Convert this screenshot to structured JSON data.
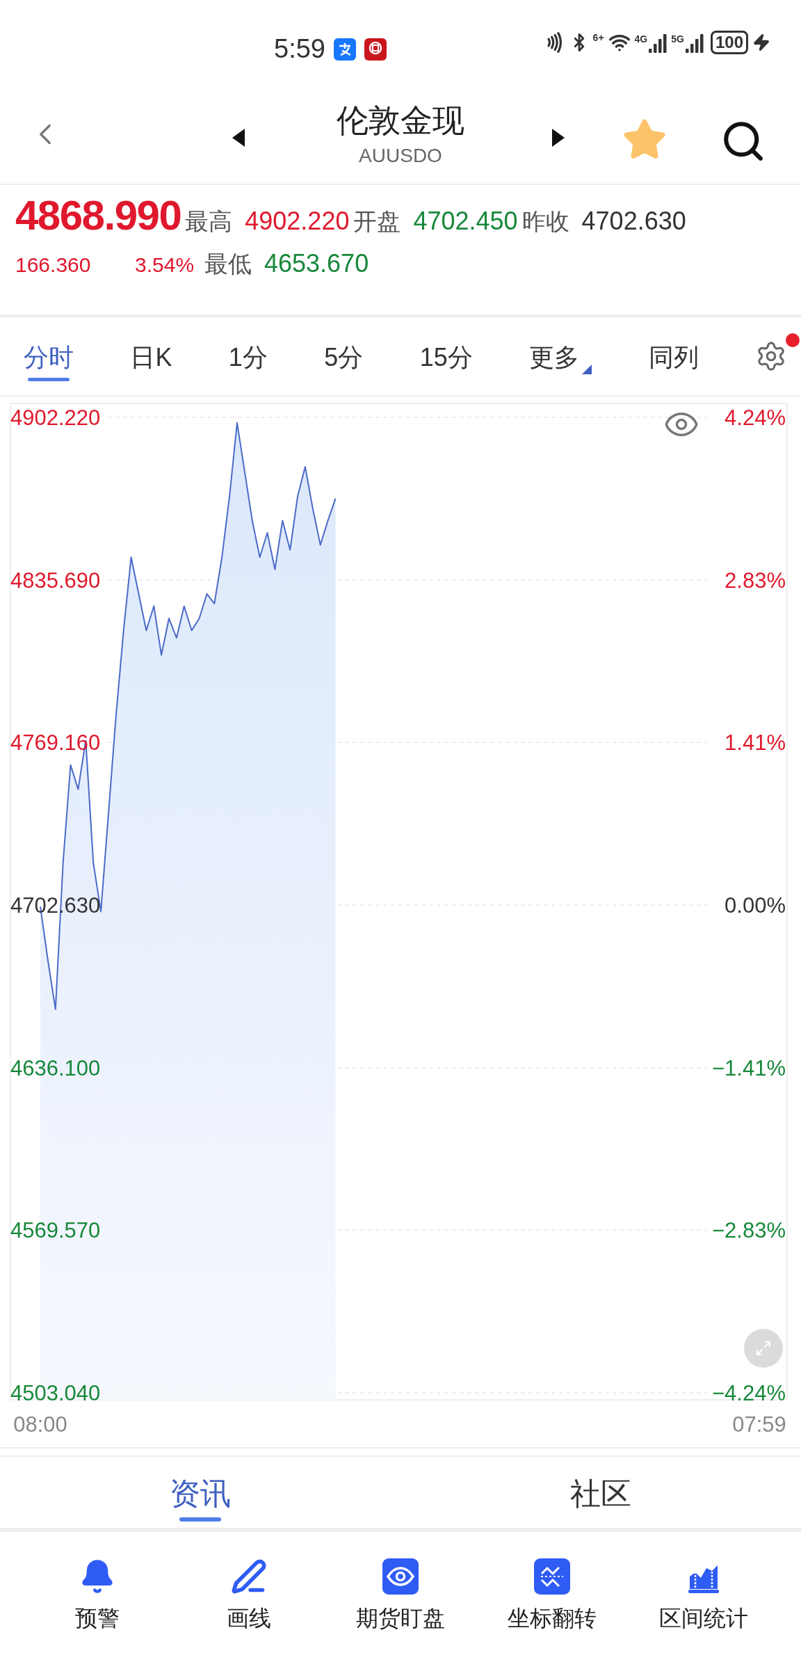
{
  "status_bar": {
    "time": "5:59",
    "wifi_label": "6+",
    "networks": [
      {
        "label": "4G"
      },
      {
        "label": "5G"
      }
    ],
    "battery": "100"
  },
  "header": {
    "title": "伦敦金现",
    "code": "AUUSDO",
    "favorite": true
  },
  "quote": {
    "price": {
      "text": "4868.990",
      "color": "#e0182d"
    },
    "change": {
      "text": "166.360",
      "color": "#e0182d"
    },
    "change_pct": {
      "text": "3.54%",
      "color": "#e0182d"
    },
    "stats": [
      {
        "label": "最高",
        "value": "4902.220",
        "color": "#e0182d"
      },
      {
        "label": "开盘",
        "value": "4702.450",
        "color": "#17883a"
      },
      {
        "label": "昨收",
        "value": "4702.630",
        "color": "#333333"
      },
      {
        "label": "最低",
        "value": "4653.670",
        "color": "#17883a"
      }
    ]
  },
  "period_tabs": [
    {
      "label": "分时",
      "selected": true
    },
    {
      "label": "日K",
      "selected": false
    },
    {
      "label": "1分",
      "selected": false
    },
    {
      "label": "5分",
      "selected": false
    },
    {
      "label": "15分",
      "selected": false
    },
    {
      "label": "更多",
      "selected": false,
      "kind": "menu"
    },
    {
      "label": "同列",
      "selected": false
    }
  ],
  "settings": {
    "badge": true
  },
  "chart": {
    "chart_data": {
      "type": "area",
      "categories": [
        "08:00",
        null,
        null,
        null,
        null,
        null,
        null,
        null,
        null,
        null,
        null,
        null,
        null,
        null,
        null,
        null,
        null,
        null,
        null,
        null,
        null,
        null,
        null,
        null,
        null,
        null,
        null,
        null,
        null,
        null,
        null,
        null,
        null,
        null,
        null,
        null,
        null,
        null,
        null,
        null,
        null,
        null,
        null,
        null,
        null,
        null,
        null,
        null,
        null,
        null,
        null,
        null,
        null,
        null,
        null,
        null,
        null,
        null,
        null,
        null,
        null,
        null,
        null,
        null,
        null,
        null,
        null,
        null,
        null,
        null,
        null,
        null,
        null,
        null,
        null,
        null,
        null,
        null,
        null,
        null,
        null,
        null,
        null,
        null,
        null,
        null,
        null,
        null,
        null,
        null,
        null,
        null,
        null,
        null,
        null,
        "07:59"
      ],
      "series": [
        {
          "color": "#4a6bc8",
          "values": [
            4702,
            4680,
            4660,
            4720,
            4760,
            4750,
            4770,
            4720,
            4700,
            4740,
            4780,
            4815,
            4845,
            4830,
            4815,
            4825,
            4805,
            4820,
            4812,
            4825,
            4815,
            4820,
            4830,
            4826,
            4845,
            4870,
            4900,
            4880,
            4860,
            4845,
            4855,
            4840,
            4860,
            4848,
            4870,
            4882,
            4865,
            4850,
            4860,
            4869,
            null,
            null,
            null,
            null,
            null,
            null,
            null,
            null,
            null,
            null,
            null,
            null,
            null,
            null,
            null,
            null,
            null,
            null,
            null,
            null,
            null,
            null,
            null,
            null,
            null,
            null,
            null,
            null,
            null,
            null,
            null,
            null,
            null,
            null,
            null,
            null,
            null,
            null,
            null,
            null,
            null,
            null,
            null,
            null,
            null,
            null,
            null,
            null,
            null,
            null,
            null,
            null,
            null,
            null,
            null,
            null
          ]
        }
      ],
      "ylim": [
        4503.04,
        4902.22
      ],
      "grid": true,
      "yticks": [
        {
          "value": 4902.22,
          "label": "4902.220"
        },
        {
          "value": 4835.69,
          "label": "4835.690"
        },
        {
          "value": 4769.16,
          "label": "4769.160"
        },
        {
          "value": 4702.63,
          "label": "4702.630"
        },
        {
          "value": 4636.1,
          "label": "4636.100"
        },
        {
          "value": 4569.57,
          "label": "4569.570"
        },
        {
          "value": 4503.04,
          "label": "4503.040"
        }
      ]
    },
    "right_axis": [
      {
        "label": "4.24%",
        "color": "#e0182d"
      },
      {
        "label": "2.83%",
        "color": "#e0182d"
      },
      {
        "label": "1.41%",
        "color": "#e0182d"
      },
      {
        "label": "0.00%",
        "color": "#333333"
      },
      {
        "label": "−1.41%",
        "color": "#17883a"
      },
      {
        "label": "−2.83%",
        "color": "#17883a"
      },
      {
        "label": "−4.24%",
        "color": "#17883a"
      }
    ]
  },
  "content_tabs": [
    {
      "label": "资讯",
      "selected": true
    },
    {
      "label": "社区",
      "selected": false
    }
  ],
  "toolbar": [
    {
      "label": "预警",
      "kind": "bell"
    },
    {
      "label": "画线",
      "kind": "pen"
    },
    {
      "label": "期货盯盘",
      "kind": "eye"
    },
    {
      "label": "坐标翻转",
      "kind": "flip"
    },
    {
      "label": "区间统计",
      "kind": "range"
    }
  ]
}
